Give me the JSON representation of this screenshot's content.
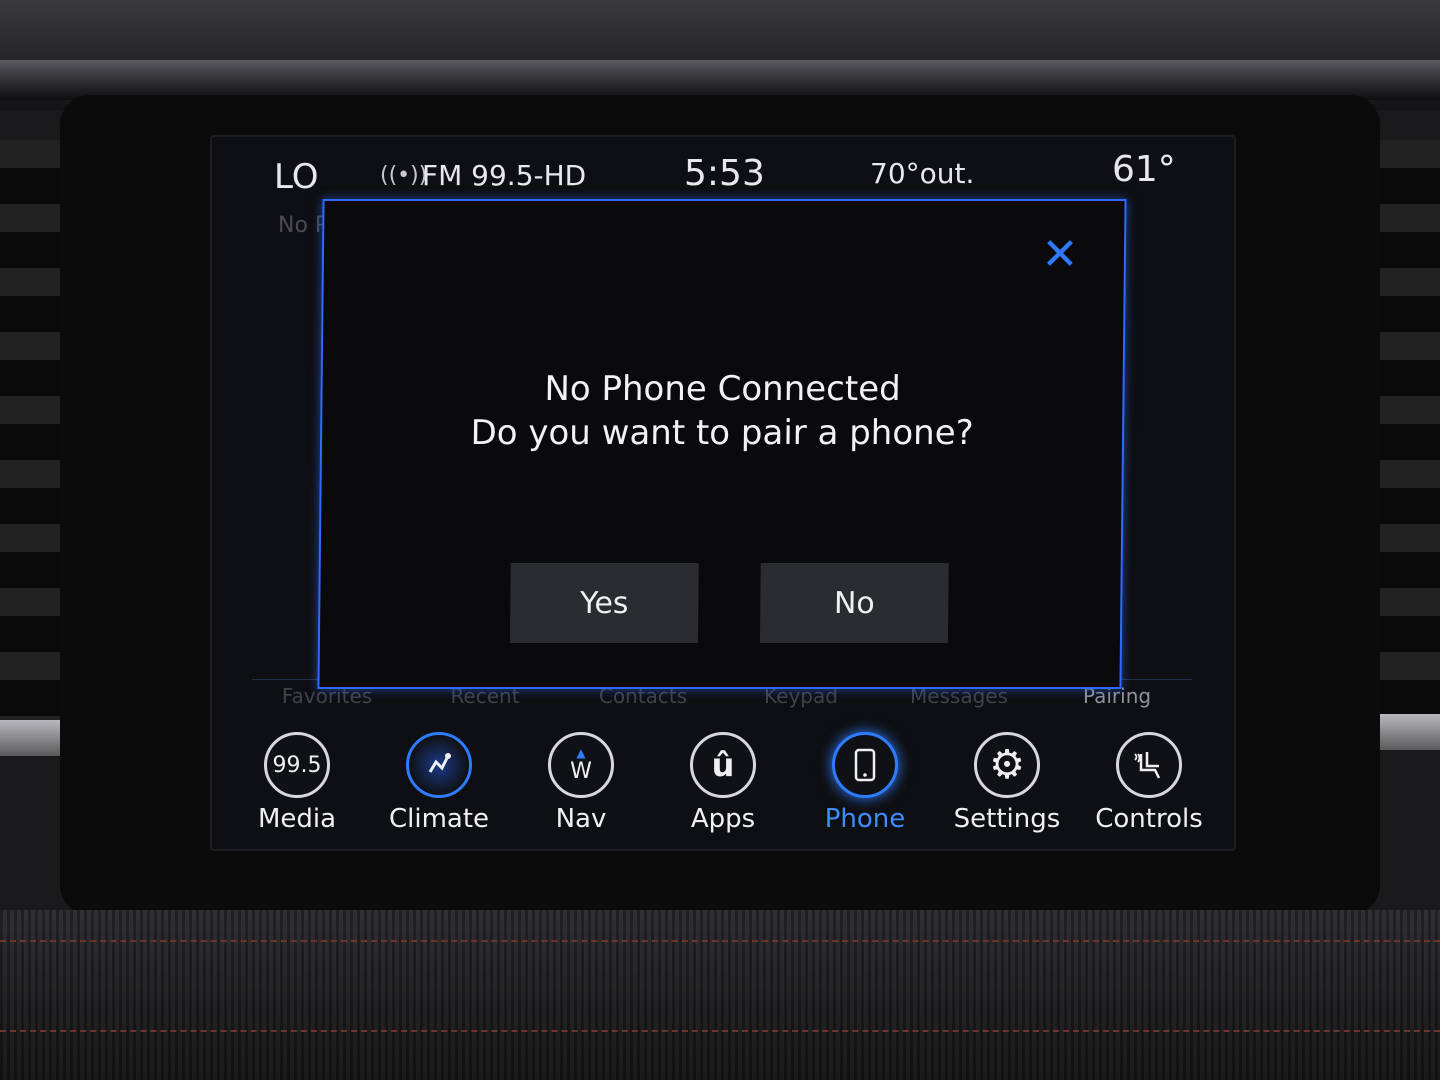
{
  "status_bar": {
    "climate_left": "LO",
    "radio_icon": "radio-signal-icon",
    "radio_station": "FM 99.5-HD",
    "time": "5:53",
    "outside_temp": "70°out.",
    "climate_right": "61°"
  },
  "background": {
    "partial_text": "No P"
  },
  "phone_tabs": [
    "Favorites",
    "Recent",
    "Contacts",
    "Keypad",
    "Messages",
    "Pairing"
  ],
  "dialog": {
    "title": "No Phone Connected",
    "message": "Do you want to pair a phone?",
    "close_icon": "close-icon",
    "yes_label": "Yes",
    "no_label": "No",
    "accent_color": "#2f6bff"
  },
  "nav": {
    "items": [
      {
        "label": "Media",
        "icon": "media-icon",
        "icon_text": "99.5"
      },
      {
        "label": "Climate",
        "icon": "climate-icon"
      },
      {
        "label": "Nav",
        "icon": "compass-icon",
        "icon_text": "W"
      },
      {
        "label": "Apps",
        "icon": "apps-icon",
        "icon_text": "û"
      },
      {
        "label": "Phone",
        "icon": "phone-icon",
        "active": true
      },
      {
        "label": "Settings",
        "icon": "gear-icon"
      },
      {
        "label": "Controls",
        "icon": "seat-controls-icon"
      }
    ],
    "active_color": "#3b8cff"
  }
}
